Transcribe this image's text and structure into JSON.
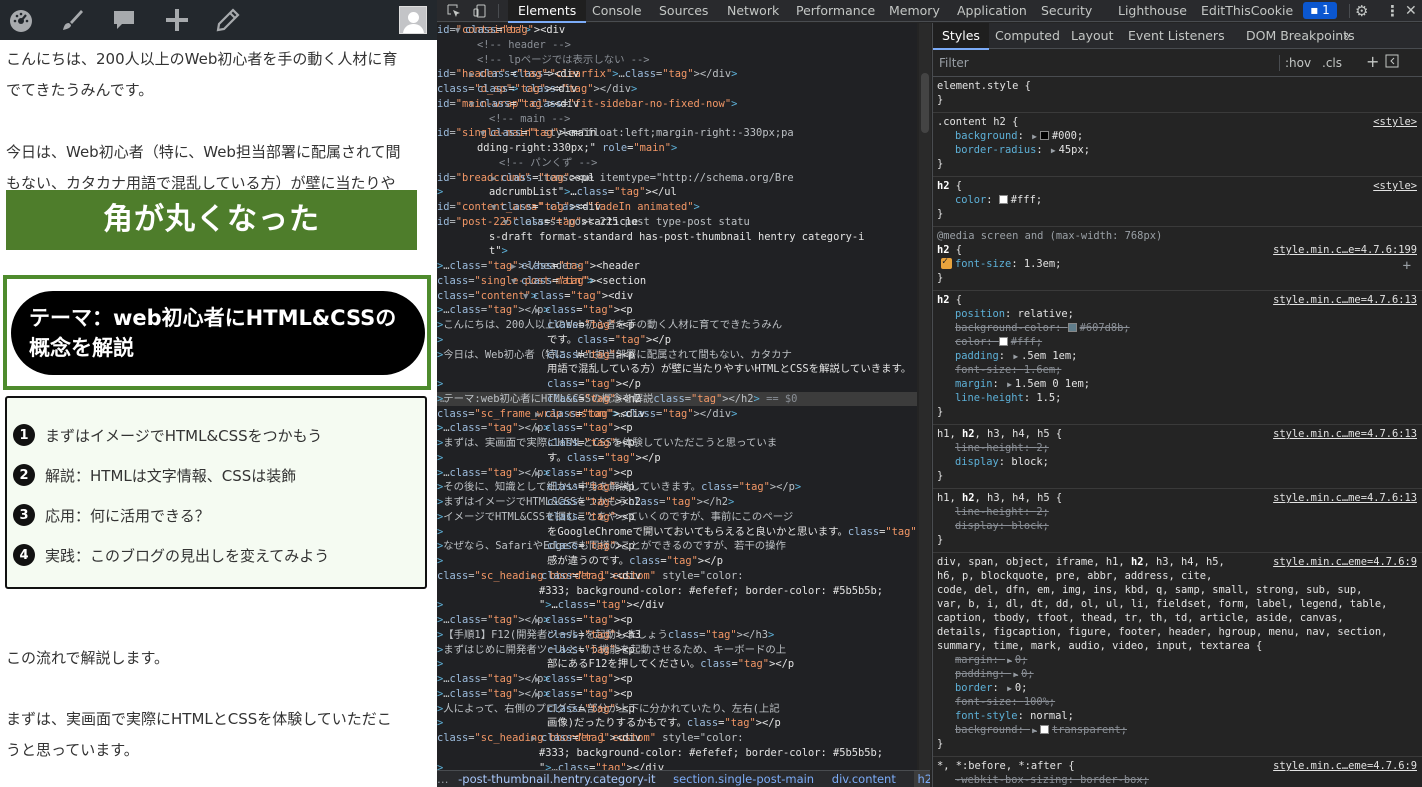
{
  "page": {
    "wpbar_icons": [
      "dashboard-icon",
      "customize-brush-icon",
      "comments-icon",
      "new-content-plus-icon",
      "edit-pencil-icon"
    ],
    "paragraph1": "こんにちは、200人以上のWeb初心者を手の動く人材に育てできたうみんです。",
    "paragraph1_line1": "こんにちは、200人以上のWeb初心者を手の動く人材に育",
    "paragraph1_line2": "でてきたうみんです。",
    "paragraph2_line1": "今日は、Web初心者（特に、Web担当部署に配属されて間",
    "paragraph2_line2": "もない、カタカナ用語で混乱している方）が壁に当たりや",
    "green_banner": "角が丸くなった",
    "theme_heading": "テーマ：web初心者にHTML&CSSの概念を解説",
    "toc": [
      {
        "num": "1",
        "label": "まずはイメージでHTML&CSSをつかもう"
      },
      {
        "num": "2",
        "label": "解説：HTMLは文字情報、CSSは装飾"
      },
      {
        "num": "3",
        "label": "応用：何に活用できる？"
      },
      {
        "num": "4",
        "label": "実践：このブログの見出しを変えてみよう"
      }
    ],
    "paragraph3": "この流れで解説します。",
    "paragraph4_line1": "まずは、実画面で実際にHTMLとCSSを体験していただこ",
    "paragraph4_line2": "うと思っています。"
  },
  "devtools": {
    "tabs": [
      "Elements",
      "Console",
      "Sources",
      "Network",
      "Performance",
      "Memory",
      "Application",
      "Security",
      "Lighthouse",
      "EditThisCookie"
    ],
    "active_tab": "Elements",
    "issues_count": "1",
    "styles_tabs": [
      "Styles",
      "Computed",
      "Layout",
      "Event Listeners",
      "DOM Breakpoints"
    ],
    "styles_more": "»",
    "filter_placeholder": "Filter",
    "hov_label": ":hov",
    "cls_label": ".cls",
    "breadcrumbs": [
      "-post-thumbnail.hentry.category-it",
      "section.single-post-main",
      "div.content",
      "h2"
    ],
    "tree": [
      "<div id=\"container\">",
      "<!-- header -->",
      "<!-- lpページでは表示しない -->",
      "<div id=\"header\" class=\"clearfix\">…</div>",
      "<div class=\"d_sp\"> </div>",
      "<div id=\"main-wrap\" class=\"fit-sidebar-no-fixed-now\">",
      "<!-- main -->",
      "<main id=\"single-main\" style=\"float:left;margin-right:-330px;pa",
      "dding-right:330px;\" role=\"main\">",
      "<!-- パンくず -->",
      "<ul id=\"breadcrumb\" itemscope itemtype=\"http://schema.org/Bre",
      "adcrumbList\">…</ul>",
      "<div id=\"content_area\" class=\"fadeIn animated\">",
      "<article id=\"post-225\" class=\"post-225 post type-post statu",
      "s-draft format-standard has-post-thumbnail hentry category-i",
      "t\">",
      "<header>…</header>",
      "<section class=\"single-post-main\">",
      "<div class=\"content\">",
      "<p>…</p>",
      "<p>こんにちは、200人以上のWeb初心者を手の動く人材に育てできたうみん",
      "です。</p>",
      "<p>今日は、Web初心者（特に、Web担当部署に配属されて間もない、カタカナ",
      "用語で混乱している方）が壁に当たりやすいHTMLとCSSを解説していきます。",
      "</p>",
      "<h2>テーマ:web初心者にHTML&CSSの概念を解説</h2> == $0",
      "<div class=\"sc_frame_wrap  custom\">…</div>",
      "<p>…</p>",
      "<p>まずは、実画面で実際にHTMLとCSSを体験していただこうと思っていま",
      "す。</p>",
      "<p>…</p>",
      "<p>その後に、知識として細かい中身を解説していきます。</p>",
      "<h2>まずはイメージでHTML&CSSをつかもう</h2>",
      "<p>イメージでHTML&CSSを掴むことをやっていくのですが、事前にこのページ",
      "をGoogleChromeで開いておいてもらえると良いかと思います。</p>",
      "<p>なぜなら、SafariやEdgeでも同様のことができるのですが、若干の操作",
      "感が違うのです。</p>",
      "<div class=\"sc_heading bborder l custom\" style=\"color:",
      "#333; background-color: #efefef; border-color: #5b5b5b;",
      "\">…</div>",
      "<p>…</p>",
      "<h3>【手順1】F12(開発者ツール)を起動しましょう</h3>",
      "<p>まずはじめに開発者ツールという機能を起動させるため、キーボードの上",
      "部にあるF12を押してください。</p>",
      "<p>…</p>",
      "<p>…</p>",
      "<p>人によって、右側のプログラム部分が上下に分かれていたり、左右(上記",
      "画像)だったりするかもです。</p>",
      "<div class=\"sc_heading bborder l custom\" style=\"color:",
      "#333; background-color: #efefef; border-color: #5b5b5b;",
      "\">…</div>"
    ],
    "rules": [
      {
        "selector": "element.style {",
        "source": "",
        "props": [],
        "close": "}"
      },
      {
        "selector": ".content h2 {",
        "source": "<style>",
        "props": [
          {
            "name": "background",
            "value": "#000;",
            "swatch": "#000000",
            "tri": true
          },
          {
            "name": "border-radius",
            "value": "45px;",
            "tri": true
          }
        ],
        "close": "}"
      },
      {
        "selector": "h2 {",
        "source": "<style>",
        "props": [
          {
            "name": "color",
            "value": "#fff;",
            "swatch": "#ffffff"
          }
        ],
        "close": "}"
      },
      {
        "media": "@media screen and (max-width: 768px)",
        "selector": "h2 {",
        "source": "style.min.c…e=4.7.6:199",
        "props": [
          {
            "name": "font-size",
            "value": "1.3em;",
            "checked": true
          }
        ],
        "close": "}"
      },
      {
        "selector": "h2 {",
        "source": "style.min.c…me=4.7.6:13",
        "props": [
          {
            "name": "position",
            "value": "relative;"
          },
          {
            "name": "background-color",
            "value": "#607d8b;",
            "swatch": "#607d8b",
            "strike": true
          },
          {
            "name": "color",
            "value": "#fff;",
            "swatch": "#ffffff",
            "strike": true
          },
          {
            "name": "padding",
            "value": ".5em 1em;",
            "tri": true
          },
          {
            "name": "font-size",
            "value": "1.6em;",
            "strike": true
          },
          {
            "name": "margin",
            "value": "1.5em 0 1em;",
            "tri": true
          },
          {
            "name": "line-height",
            "value": "1.5;"
          }
        ],
        "close": "}"
      },
      {
        "selector": "h1, h2, h3, h4, h5 {",
        "source": "style.min.c…me=4.7.6:13",
        "props": [
          {
            "name": "line-height",
            "value": "2;",
            "strike": true
          },
          {
            "name": "display",
            "value": "block;"
          }
        ],
        "close": "}"
      },
      {
        "selector": "h1, h2, h3, h4, h5 {",
        "source": "style.min.c…me=4.7.6:13",
        "props": [
          {
            "name": "line-height",
            "value": "2;",
            "strike": true
          },
          {
            "name": "display",
            "value": "block;",
            "strike": true
          }
        ],
        "close": "}"
      },
      {
        "selector_lines": [
          "div, span, object, iframe, h1, h2, h3, h4, h5,",
          "h6, p, blockquote, pre, abbr, address, cite,",
          "code, del, dfn, em, img, ins, kbd, q, samp, small, strong, sub, sup,",
          "var, b, i, dl, dt, dd, ol, ul, li, fieldset, form, label, legend, table,",
          "caption, tbody, tfoot, thead, tr, th, td, article, aside, canvas,",
          "details, figcaption, figure, footer, header, hgroup, menu, nav, section,",
          "summary, time, mark, audio, video, input, textarea {"
        ],
        "source": "style.min.c…eme=4.7.6:9",
        "props": [
          {
            "name": "margin",
            "value": "0;",
            "tri": true,
            "strike": true
          },
          {
            "name": "padding",
            "value": "0;",
            "tri": true,
            "strike": true
          },
          {
            "name": "border",
            "value": "0;",
            "tri": true
          },
          {
            "name": "font-size",
            "value": "100%;",
            "strike": true
          },
          {
            "name": "font-style",
            "value": "normal;"
          },
          {
            "name": "background",
            "value": "transparent;",
            "swatch": "#ffffff",
            "tri": true,
            "strike": true
          }
        ],
        "close": "}"
      },
      {
        "selector": "*, *:before, *:after {",
        "source": "style.min.c…eme=4.7.6:9",
        "props": [
          {
            "name": "-webkit-box-sizing",
            "value": "border-box;",
            "strike": true
          }
        ],
        "close": ""
      }
    ]
  }
}
